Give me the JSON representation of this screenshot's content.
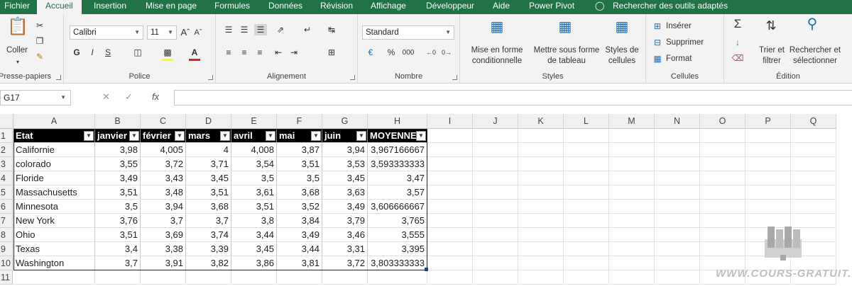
{
  "tabs": [
    "Fichier",
    "Accueil",
    "Insertion",
    "Mise en page",
    "Formules",
    "Données",
    "Révision",
    "Affichage",
    "Développeur",
    "Aide",
    "Power Pivot",
    "Rechercher des outils adaptés"
  ],
  "ribbon": {
    "clipboard": {
      "label": "Presse-papiers",
      "paste": "Coller"
    },
    "font": {
      "label": "Police",
      "name": "Calibri",
      "size": "11",
      "bold": "G",
      "italic": "I",
      "underline": "S"
    },
    "alignment": {
      "label": "Alignement"
    },
    "number": {
      "label": "Nombre",
      "format": "Standard",
      "percent": "%",
      "thousands": "000"
    },
    "styles": {
      "label": "Styles",
      "cond_format": "Mise en forme conditionnelle",
      "as_table": "Mettre sous forme de tableau",
      "cell_styles": "Styles de cellules"
    },
    "cells": {
      "label": "Cellules",
      "insert": "Insérer",
      "delete": "Supprimer",
      "format": "Format"
    },
    "editing": {
      "label": "Édition",
      "sort": "Trier et filtrer",
      "find": "Rechercher et sélectionner"
    }
  },
  "formula_bar": {
    "name_box": "G17",
    "fx": "fx",
    "value": ""
  },
  "columns": [
    "A",
    "B",
    "C",
    "D",
    "E",
    "F",
    "G",
    "H",
    "I",
    "J",
    "K",
    "L",
    "M",
    "N",
    "O",
    "P",
    "Q"
  ],
  "rows": [
    "1",
    "2",
    "3",
    "4",
    "5",
    "6",
    "7",
    "8",
    "9",
    "10",
    "11"
  ],
  "table": {
    "headers": [
      "Etat",
      "janvier",
      "février",
      "mars",
      "avril",
      "mai",
      "juin",
      "MOYENNE"
    ],
    "data": [
      [
        "Californie",
        "3,98",
        "4,005",
        "4",
        "4,008",
        "3,87",
        "3,94",
        "3,967166667"
      ],
      [
        "colorado",
        "3,55",
        "3,72",
        "3,71",
        "3,54",
        "3,51",
        "3,53",
        "3,593333333"
      ],
      [
        "Floride",
        "3,49",
        "3,43",
        "3,45",
        "3,5",
        "3,5",
        "3,45",
        "3,47"
      ],
      [
        "Massachusetts",
        "3,51",
        "3,48",
        "3,51",
        "3,61",
        "3,68",
        "3,63",
        "3,57"
      ],
      [
        "Minnesota",
        "3,5",
        "3,94",
        "3,68",
        "3,51",
        "3,52",
        "3,49",
        "3,606666667"
      ],
      [
        "New York",
        "3,76",
        "3,7",
        "3,7",
        "3,8",
        "3,84",
        "3,79",
        "3,765"
      ],
      [
        "Ohio",
        "3,51",
        "3,69",
        "3,74",
        "3,44",
        "3,49",
        "3,46",
        "3,555"
      ],
      [
        "Texas",
        "3,4",
        "3,38",
        "3,39",
        "3,45",
        "3,44",
        "3,31",
        "3,395"
      ],
      [
        "Washington",
        "3,7",
        "3,91",
        "3,82",
        "3,86",
        "3,81",
        "3,72",
        "3,803333333"
      ]
    ]
  },
  "watermark": "WWW.COURS-GRATUIT.COM",
  "colors": {
    "excel_green": "#217346",
    "header_fill": "#000000",
    "ribbon_bg": "#f3f3f3"
  }
}
